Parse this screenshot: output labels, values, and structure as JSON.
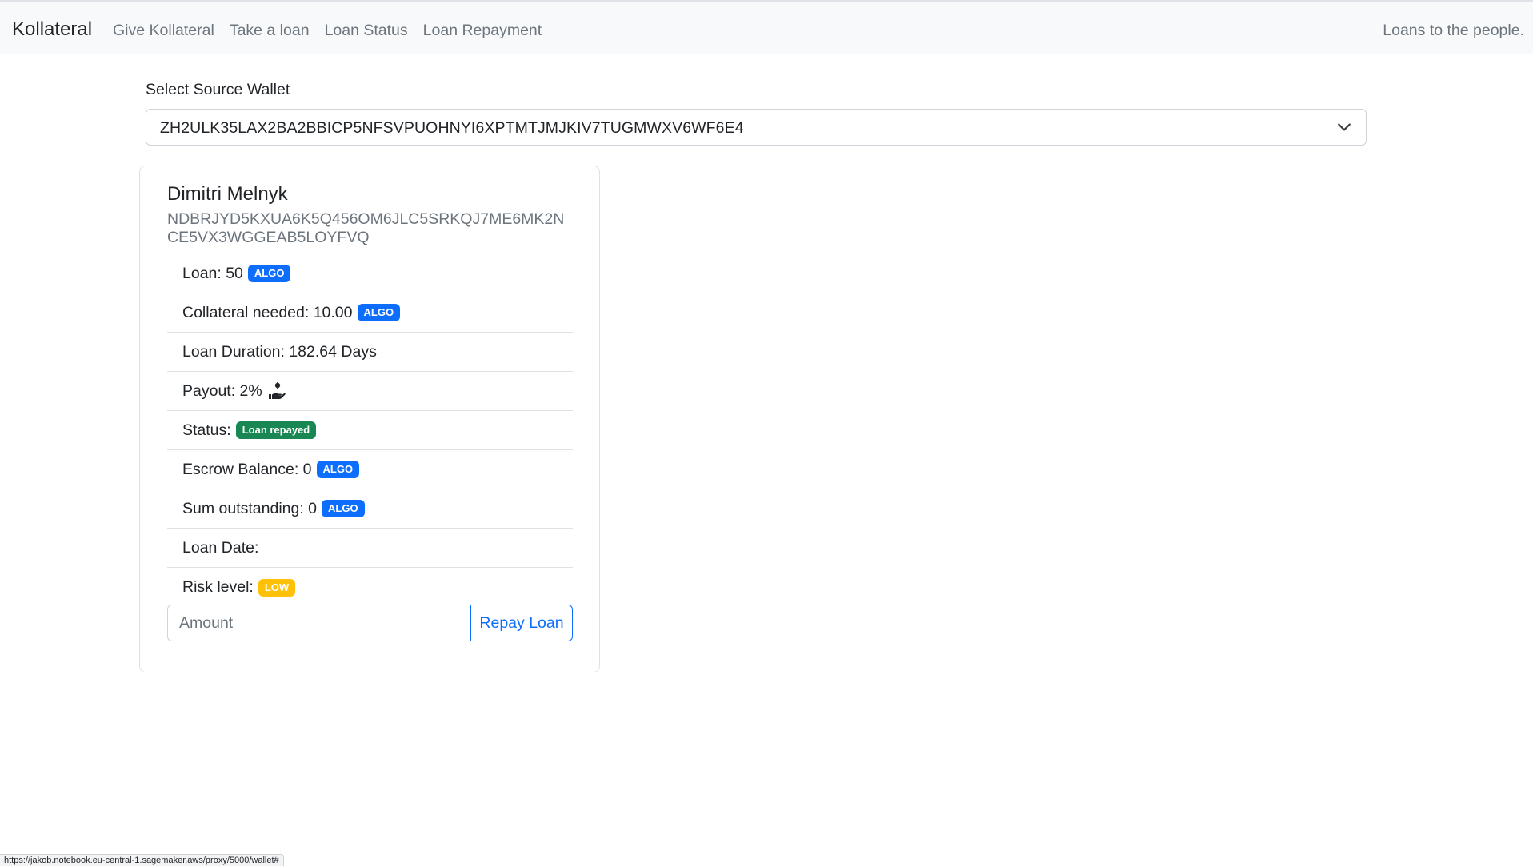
{
  "navbar": {
    "brand": "Kollateral",
    "links": [
      "Give Kollateral",
      "Take a loan",
      "Loan Status",
      "Loan Repayment"
    ],
    "tagline": "Loans to the people."
  },
  "wallet": {
    "label": "Select Source Wallet",
    "selected": "ZH2ULK35LAX2BA2BBICP5NFSVPUOHNYI6XPTMTJMJKIV7TUGMWXV6WF6E4"
  },
  "loan": {
    "name": "Dimitri Melnyk",
    "address": "NDBRJYD5KXUA6K5Q456OM6JLC5SRKQJ7ME6MK2NCE5VX3WGGEAB5LOYFVQ",
    "items": {
      "loan_label": "Loan: 50",
      "loan_unit": "ALGO",
      "collateral_label": "Collateral needed: 10.00",
      "collateral_unit": "ALGO",
      "duration_label": "Loan Duration: 182.64 Days",
      "payout_label": "Payout: 2%",
      "status_label": "Status:",
      "status_value": "Loan repayed",
      "escrow_label": "Escrow Balance: 0",
      "escrow_unit": "ALGO",
      "outstanding_label": "Sum outstanding: 0",
      "outstanding_unit": "ALGO",
      "date_label": "Loan Date:",
      "risk_label": "Risk level:",
      "risk_value": "LOW"
    },
    "amount_placeholder": "Amount",
    "repay_label": "Repay Loan"
  },
  "status_bar": {
    "url": "https://jakob.notebook.eu-central-1.sagemaker.aws/proxy/5000/wallet#"
  },
  "colors": {
    "primary": "#0d6efd",
    "success": "#198754",
    "warning": "#ffc107",
    "navbar_bg": "#f8f9fa"
  },
  "icons": {
    "select_chevron": "chevron-down-icon",
    "payout": "hand-holding-dollar-icon"
  }
}
